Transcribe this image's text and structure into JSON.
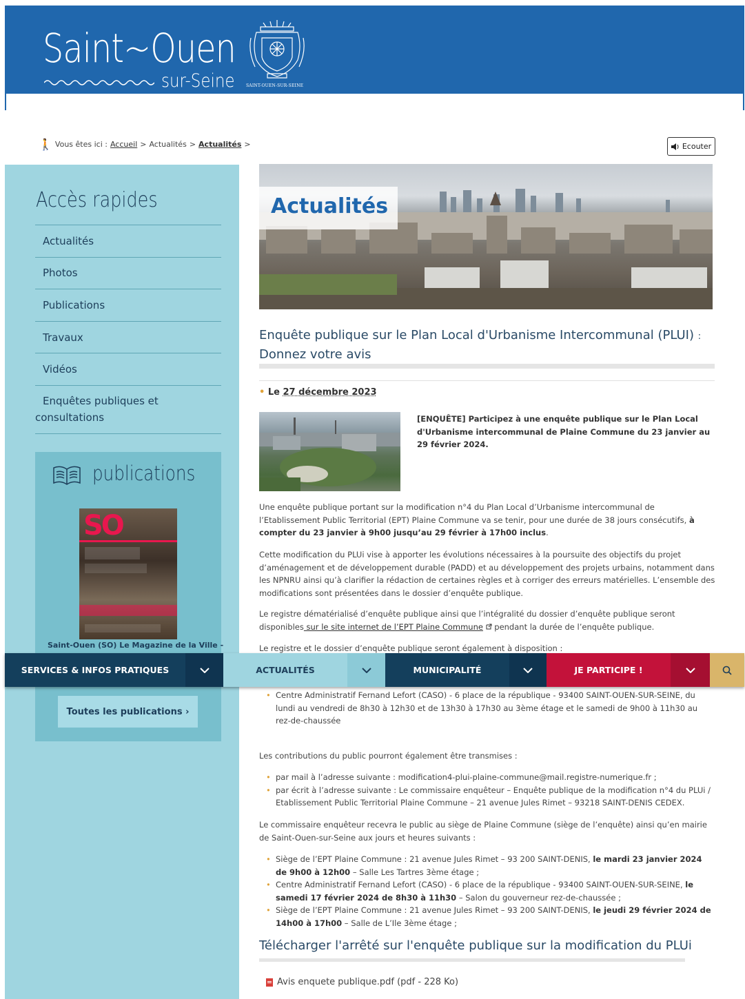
{
  "header": {
    "logo_main": "Saint~Ouen",
    "logo_sub": "sur-Seine",
    "crest_label": "SAINT-OUEN-SUR-SEINE"
  },
  "breadcrumb": {
    "prefix": "Vous êtes ici :",
    "items": [
      "Accueil",
      "Actualités",
      "Actualités"
    ],
    "separator": ">"
  },
  "listen_button": "Ecouter",
  "sidebar": {
    "title": "Accès rapides",
    "items": [
      "Actualités",
      "Photos",
      "Publications",
      "Travaux",
      "Vidéos",
      "Enquêtes publiques et",
      "consultations"
    ],
    "publications": {
      "title": "publications",
      "magazine_cover": "SO",
      "caption": "Saint-Ouen (SO) Le Magazine de la Ville -",
      "button": "Toutes les publications ›"
    }
  },
  "hero": {
    "title": "Actualités"
  },
  "article": {
    "title": "Enquête publique sur le Plan Local d'Urbanisme Intercommunal (PLUI)",
    "title_suffix": ":",
    "title_line2": "Donnez votre avis",
    "date_prefix": "Le",
    "date": "27 décembre 2023",
    "intro": "[ENQUÊTE] Participez à une enquête publique sur le  Plan Local d'Urbanisme intercommunal de Plaine Commune du 23 janvier au 29 février 2024.",
    "p1_a": "Une enquête publique portant sur la modification n°4 du Plan Local d’Urbanisme intercommunal de l’Etablissement Public Territorial (EPT) Plaine Commune va se tenir, pour une durée de 38 jours consécutifs,",
    "p1_b": "à compter du 23 janvier à 9h00 jusqu’au 29 février à 17h00 inclus",
    "p1_c": ".",
    "p2": "Cette modification du PLUi vise à apporter les évolutions nécessaires à la poursuite des objectifs du projet d’aménagement et de développement durable  (PADD) et au développement des projets urbains, notamment dans les NPNRU ainsi qu’à clarifier la rédaction de certaines règles et à corriger des erreurs matérielles. L’ensemble des modifications sont présentées dans le dossier d’enquête publique.",
    "p3_a": "Le registre dématérialisé d’enquête publique ainsi que l’intégralité du dossier d’enquête publique seront disponibles",
    "p3_link": " sur le site internet de l’EPT Plaine Commune",
    "p3_b": " pendant la durée de l’enquête publique.",
    "p4": "Le registre et le dossier d’enquête publique seront également à disposition :",
    "bullet_caso": "Centre Administratif Fernand Lefort (CASO) - 6 place de la république - 93400 SAINT-OUEN-SUR-SEINE, du lundi au vendredi de 8h30 à 12h30 et de 13h30 à 17h30 au 3ème étage et le samedi de 9h00 à 11h30 au rez-de-chaussée",
    "p5": "Les contributions du public pourront également être transmises :",
    "contrib": [
      "par mail à l’adresse suivante : modification4-plui-plaine-commune@mail.registre-numerique.fr ;",
      "par écrit à l’adresse suivante : Le commissaire enquêteur – Enquête publique de la modification n°4 du PLUi / Etablissement Public Territorial Plaine Commune – 21 avenue Jules Rimet – 93218 SAINT-DENIS CEDEX."
    ],
    "p6": "Le commissaire enquêteur recevra le public au siège de Plaine Commune (siège de l’enquête) ainsi qu’en mairie de Saint-Ouen-sur-Seine aux jours et heures suivants :",
    "perm1_a": "Siège de l’EPT Plaine Commune : 21 avenue Jules Rimet – 93 200 SAINT-DENIS,",
    "perm1_b": "le mardi 23 janvier 2024 de 9h00 à 12h00",
    "perm1_c": " – Salle Les Tartres 3ème étage ;",
    "perm2_a": "Centre Administratif Fernand Lefort (CASO) - 6 place de la république - 93400 SAINT-OUEN-SUR-SEINE,",
    "perm2_b": "le samedi 17 février 2024 de 8h30 à 11h30",
    "perm2_c": " – Salon du gouverneur rez-de-chaussée ;",
    "perm3_a": "Siège de l’EPT Plaine Commune : 21 avenue Jules Rimet – 93 200 SAINT-DENIS,",
    "perm3_b": "le jeudi 29 février 2024 de 14h00 à 17h00",
    "perm3_c": " – Salle de L’Ile 3ème étage ;",
    "download_title": "Télécharger l'arrêté sur l'enquête publique sur la modification du PLUi",
    "download_file": "Avis enquete publique.pdf (pdf - 228 Ko)"
  },
  "navbar": {
    "items": [
      {
        "label": "SERVICES & INFOS PRATIQUES",
        "bg": "#143f5c",
        "chev_bg": "#0f3450"
      },
      {
        "label": "ACTUALITÉS",
        "bg": "#9fd5e0",
        "chev_bg": "#8ccad7",
        "fg": "#1d3e5a"
      },
      {
        "label": "MUNICIPALITÉ",
        "bg": "#143f5c",
        "chev_bg": "#0f3450"
      },
      {
        "label": "JE PARTICIPE !",
        "bg": "#c3123a",
        "chev_bg": "#a50f31"
      }
    ],
    "search_bg": "#d9b56a"
  },
  "colors": {
    "brand_blue": "#2067ad",
    "sidebar": "#9fd5e0",
    "accent_orange": "#e0a33a"
  }
}
